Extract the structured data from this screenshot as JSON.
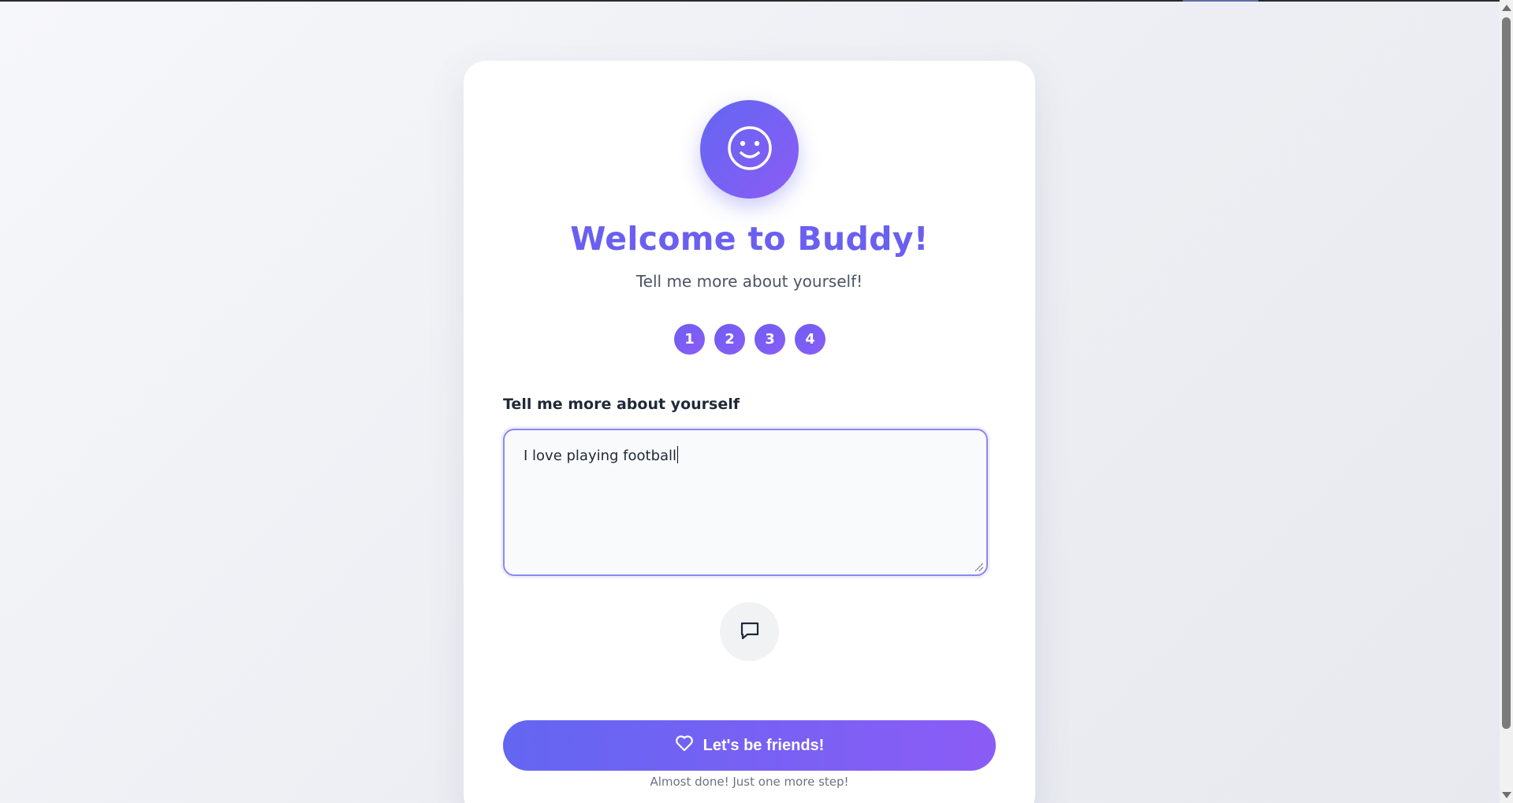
{
  "colors": {
    "accent": "#6a5ff0",
    "gradient_start": "#6366f1",
    "gradient_end": "#8b5cf6",
    "muted_text": "#6b7280"
  },
  "header": {
    "avatar_icon": "smiley-face-icon",
    "title": "Welcome to Buddy!",
    "subtitle": "Tell me more about yourself!"
  },
  "steps": [
    "1",
    "2",
    "3",
    "4"
  ],
  "form": {
    "label": "Tell me more about yourself",
    "textarea_value": "I love playing football"
  },
  "chat_button": {
    "icon": "speech-bubble-icon"
  },
  "cta": {
    "icon": "heart-icon",
    "label": "Let's be friends!"
  },
  "hint": "Almost done! Just one more step!"
}
